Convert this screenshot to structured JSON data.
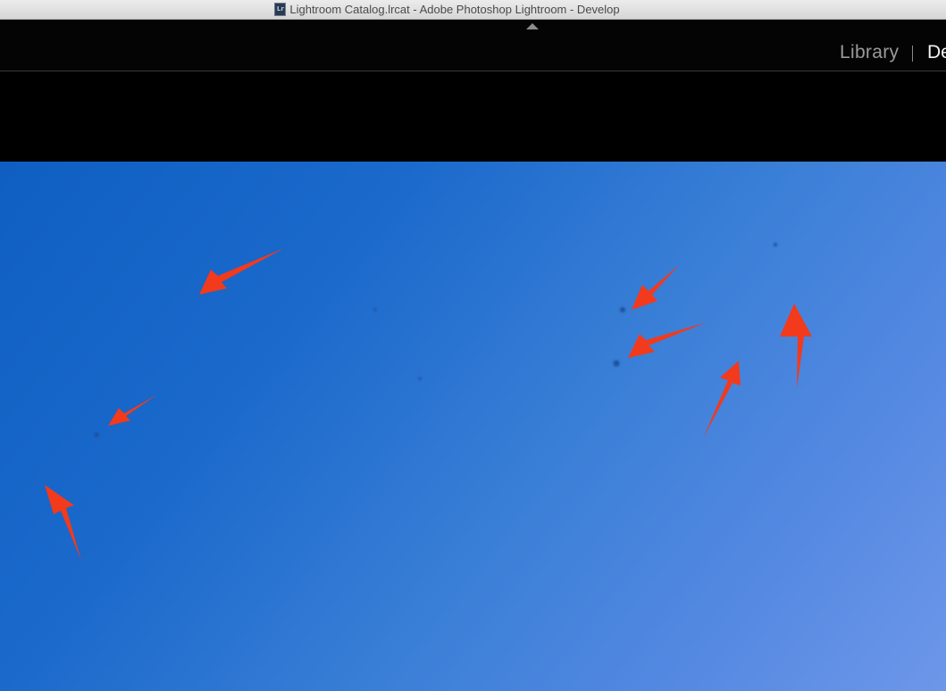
{
  "window": {
    "title": "Lightroom Catalog.lrcat - Adobe Photoshop Lightroom - Develop",
    "doc_icon_label": "Lr"
  },
  "modules": {
    "library": "Library",
    "develop": "De",
    "active": "develop"
  },
  "colors": {
    "annotation_arrow": "#f23a1c",
    "sky_top_left": "#0f5ec2",
    "sky_bottom_right": "#6d97e9",
    "dust_spot": "#1d4f9e"
  },
  "icons": {
    "collapse_top_panel": "triangle-up-icon",
    "document": "lightroom-catalog-icon"
  }
}
